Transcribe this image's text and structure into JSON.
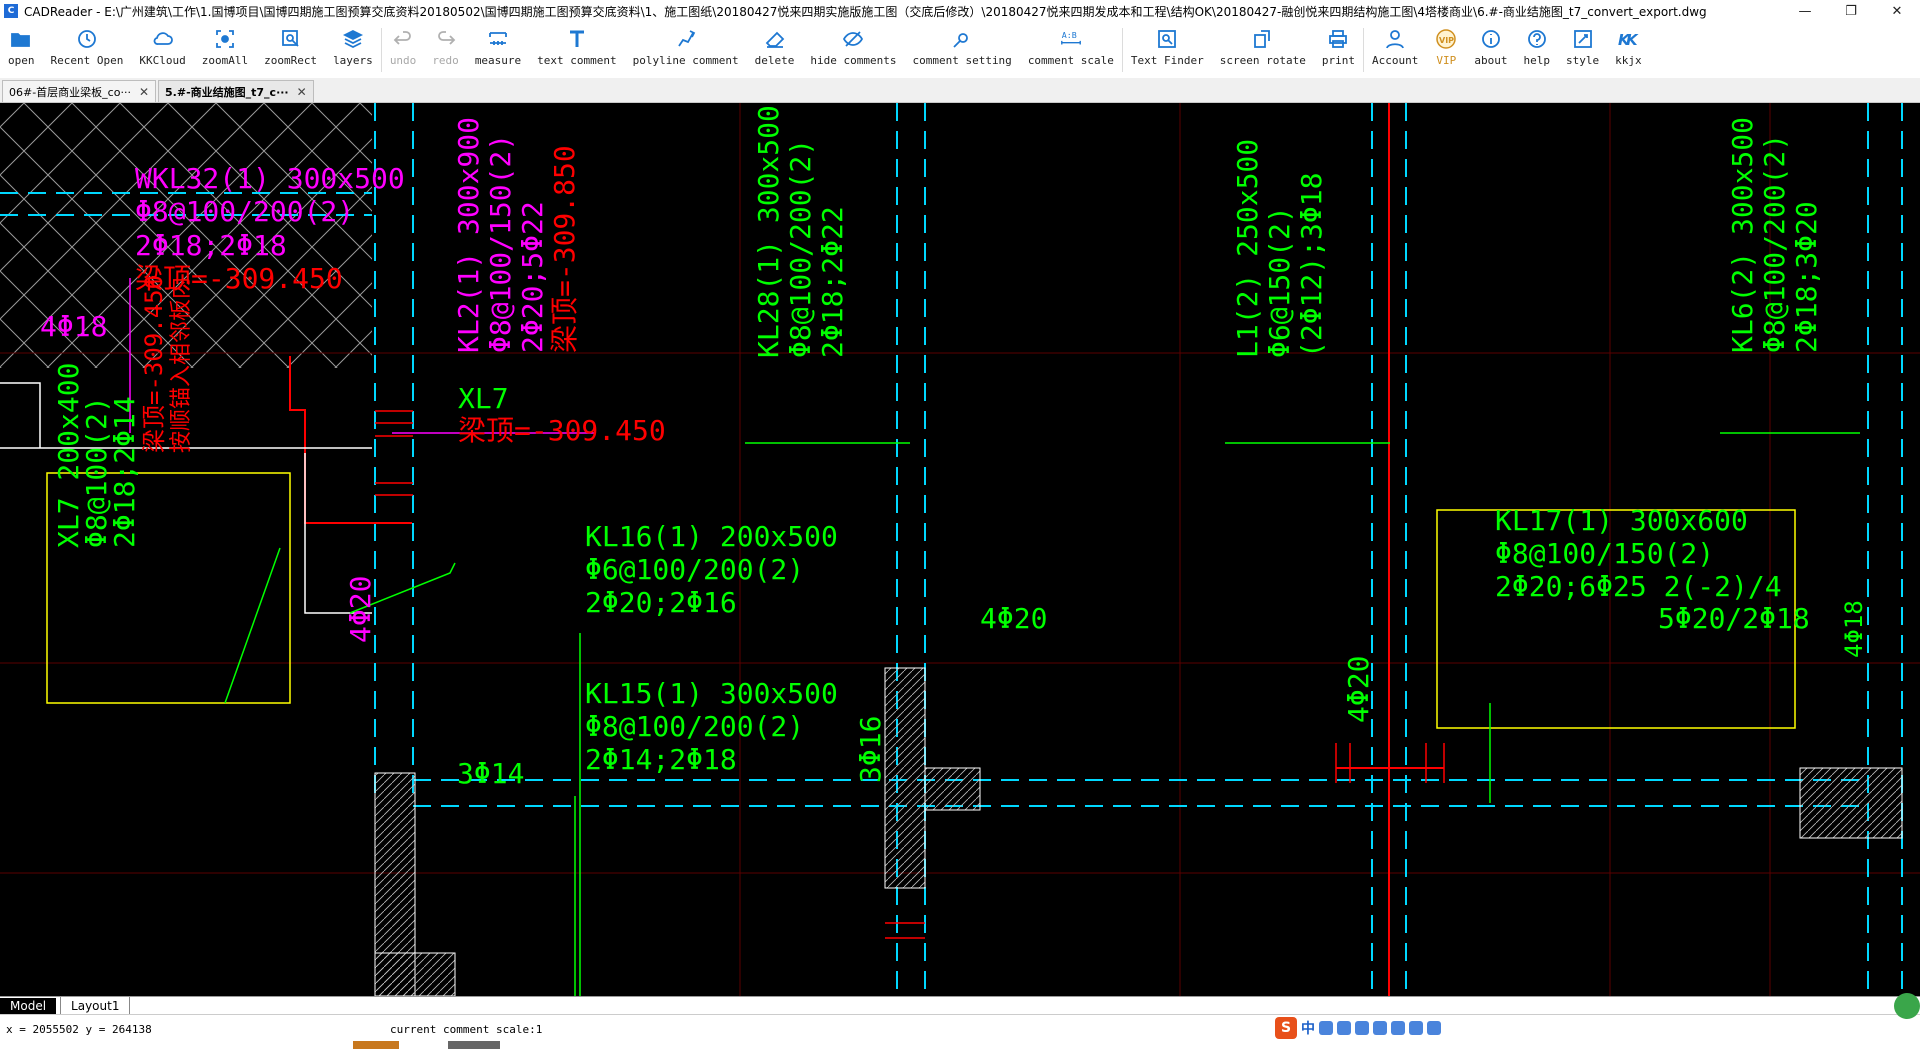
{
  "window": {
    "title": "CADReader - E:\\广州建筑\\工作\\1.国博项目\\国博四期施工图预算交底资料20180502\\国博四期施工图预算交底资料\\1、施工图纸\\20180427悦来四期实施版施工图（交底后修改）\\20180427悦来四期发成本和工程\\结构OK\\20180427-融创悦来四期结构施工图\\4塔楼商业\\6.#-商业结施图_t7_convert_export.dwg",
    "app_icon": "C",
    "minimize": "—",
    "maximize": "❐",
    "close": "✕"
  },
  "toolbar": [
    {
      "label": "open",
      "icon": "folder-open-icon",
      "color": "#1e78d2"
    },
    {
      "label": "Recent Open",
      "icon": "clock-icon",
      "color": "#1e78d2"
    },
    {
      "label": "KKCloud",
      "icon": "cloud-icon",
      "color": "#1e78d2"
    },
    {
      "label": "zoomAll",
      "icon": "zoom-all-icon",
      "color": "#1e78d2"
    },
    {
      "label": "zoomRect",
      "icon": "zoom-rect-icon",
      "color": "#1e78d2"
    },
    {
      "label": "layers",
      "icon": "layers-icon",
      "color": "#1e78d2"
    },
    {
      "sep": true
    },
    {
      "label": "undo",
      "icon": "undo-icon",
      "color": "#b0b0b0",
      "disabled": true
    },
    {
      "label": "redo",
      "icon": "redo-icon",
      "color": "#b0b0b0",
      "disabled": true
    },
    {
      "label": "measure",
      "icon": "measure-icon",
      "color": "#1e78d2"
    },
    {
      "label": "text comment",
      "icon": "text-comment-icon",
      "color": "#1e78d2"
    },
    {
      "label": "polyline comment",
      "icon": "polyline-icon",
      "color": "#1e78d2"
    },
    {
      "label": "delete",
      "icon": "eraser-icon",
      "color": "#1e78d2"
    },
    {
      "label": "hide comments",
      "icon": "eye-off-icon",
      "color": "#1e78d2"
    },
    {
      "label": "comment setting",
      "icon": "comment-setting-icon",
      "color": "#1e78d2"
    },
    {
      "label": "comment scale",
      "icon": "comment-scale-icon",
      "color": "#1e78d2"
    },
    {
      "sep": true
    },
    {
      "label": "Text Finder",
      "icon": "text-finder-icon",
      "color": "#1e78d2"
    },
    {
      "label": "screen rotate",
      "icon": "rotate-icon",
      "color": "#1e78d2"
    },
    {
      "label": "print",
      "icon": "printer-icon",
      "color": "#1e78d2"
    },
    {
      "sep": true
    },
    {
      "label": "Account",
      "icon": "user-icon",
      "color": "#1e78d2"
    },
    {
      "label": "VIP",
      "icon": "vip-icon",
      "color": "#d09020",
      "vip": true
    },
    {
      "label": "about",
      "icon": "info-icon",
      "color": "#1e78d2"
    },
    {
      "label": "help",
      "icon": "help-icon",
      "color": "#1e78d2"
    },
    {
      "label": "style",
      "icon": "style-icon",
      "color": "#1e78d2"
    },
    {
      "label": "kkjx",
      "icon": "kk-icon",
      "color": "#1e78d2"
    }
  ],
  "tabs": [
    {
      "label": "06#-首层商业梁板_co···",
      "active": false,
      "close": "✕"
    },
    {
      "label": "5.#-商业结施图_t7_c···",
      "active": true,
      "close": "✕"
    }
  ],
  "drawing": {
    "colors": {
      "bg": "#000000",
      "green": "#00ff00",
      "magenta": "#ff00ff",
      "red": "#ff0000",
      "cyan": "#00ffff",
      "yellow": "#ffff00",
      "white": "#ffffff",
      "grey": "#808080",
      "darkred": "#8b0000"
    },
    "labels": [
      {
        "id": "wkl32-1",
        "text": "WKL32(1) 300x500",
        "color": "#ff00ff"
      },
      {
        "id": "wkl32-2",
        "text": "Φ8@100/200(2)",
        "color": "#ff00ff"
      },
      {
        "id": "wkl32-3",
        "text": "2Φ18;2Φ18",
        "color": "#ff00ff"
      },
      {
        "id": "wkl32-4",
        "text": "梁顶=-309.450",
        "color": "#ff0000"
      },
      {
        "id": "wkl32-bar",
        "text": "4Φ18",
        "color": "#ff00ff"
      },
      {
        "id": "kl2-1",
        "text": "KL2(1) 300x900",
        "color": "#ff00ff"
      },
      {
        "id": "kl2-2",
        "text": "Φ8@100/150(2)",
        "color": "#ff00ff"
      },
      {
        "id": "kl2-3",
        "text": "2Φ20;5Φ22",
        "color": "#ff00ff"
      },
      {
        "id": "kl2-4",
        "text": "梁顶=-309.850",
        "color": "#ff0000"
      },
      {
        "id": "xl7-a1",
        "text": "XL7",
        "color": "#00ff00"
      },
      {
        "id": "xl7-a2",
        "text": "梁顶=-309.450",
        "color": "#ff0000"
      },
      {
        "id": "xl7-b1",
        "text": "XL7 200x400",
        "color": "#00ff00"
      },
      {
        "id": "xl7-b2",
        "text": "Φ8@100(2)",
        "color": "#00ff00"
      },
      {
        "id": "xl7-b3",
        "text": "2Φ18;2Φ14",
        "color": "#00ff00"
      },
      {
        "id": "xl7-b4",
        "text": "梁顶=-309.450",
        "color": "#ff0000"
      },
      {
        "id": "xl7-b5",
        "text": "按顺锚入相邻板内",
        "color": "#ff0000"
      },
      {
        "id": "kl28-1",
        "text": "KL28(1) 300x500",
        "color": "#00ff00"
      },
      {
        "id": "kl28-2",
        "text": "Φ8@100/200(2)",
        "color": "#00ff00"
      },
      {
        "id": "kl28-3",
        "text": "2Φ18;2Φ22",
        "color": "#00ff00"
      },
      {
        "id": "l1-1",
        "text": "L1(2) 250x500",
        "color": "#00ff00"
      },
      {
        "id": "l1-2",
        "text": "Φ6@150(2)",
        "color": "#00ff00"
      },
      {
        "id": "l1-3",
        "text": "(2Φ12);3Φ18",
        "color": "#00ff00"
      },
      {
        "id": "kl6-1",
        "text": "KL6(2) 300x500",
        "color": "#00ff00"
      },
      {
        "id": "kl6-2",
        "text": "Φ8@100/200(2)",
        "color": "#00ff00"
      },
      {
        "id": "kl6-3",
        "text": "2Φ18;3Φ20",
        "color": "#00ff00"
      },
      {
        "id": "kl16-1",
        "text": "KL16(1) 200x500",
        "color": "#00ff00"
      },
      {
        "id": "kl16-2",
        "text": "Φ6@100/200(2)",
        "color": "#00ff00"
      },
      {
        "id": "kl16-3",
        "text": "2Φ20;2Φ16",
        "color": "#00ff00"
      },
      {
        "id": "kl15-1",
        "text": "KL15(1) 300x500",
        "color": "#00ff00"
      },
      {
        "id": "kl15-2",
        "text": "Φ8@100/200(2)",
        "color": "#00ff00"
      },
      {
        "id": "kl15-3",
        "text": "2Φ14;2Φ18",
        "color": "#00ff00"
      },
      {
        "id": "kl17-1",
        "text": "KL17(1) 300x600",
        "color": "#00ff00"
      },
      {
        "id": "kl17-2",
        "text": "Φ8@100/150(2)",
        "color": "#00ff00"
      },
      {
        "id": "kl17-3",
        "text": "2Φ20;6Φ25 2(-2)/4",
        "color": "#00ff00"
      },
      {
        "id": "bar-4d20-a",
        "text": "4Φ20",
        "color": "#ff00ff"
      },
      {
        "id": "bar-4d20-b",
        "text": "4Φ20",
        "color": "#00ff00"
      },
      {
        "id": "bar-4d20-c",
        "text": "4Φ20",
        "color": "#00ff00"
      },
      {
        "id": "bar-3d14",
        "text": "3Φ14",
        "color": "#00ff00"
      },
      {
        "id": "bar-3d16",
        "text": "3Φ16",
        "color": "#00ff00"
      },
      {
        "id": "bar-5d20",
        "text": "5Φ20/2Φ18",
        "color": "#00ff00"
      },
      {
        "id": "bar-4d18",
        "text": "4Φ18",
        "color": "#00ff00"
      }
    ]
  },
  "layout_tabs": [
    {
      "label": "Model",
      "active": true
    },
    {
      "label": "Layout1",
      "active": false
    }
  ],
  "status": {
    "coords": "x = 2055502 y = 264138",
    "comment_scale": "current comment scale:1",
    "ime_logo": "S",
    "ime_lang": "中"
  }
}
